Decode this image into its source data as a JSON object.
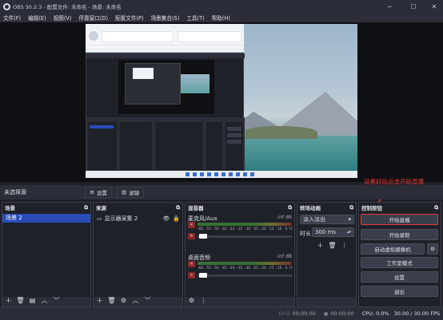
{
  "window": {
    "title": "OBS 30.2.3 - 配置文件: 未命名 - 场景: 未命名"
  },
  "menu": [
    "文件(F)",
    "编辑(E)",
    "视图(V)",
    "停靠窗口(D)",
    "配置文件(P)",
    "场景集合(S)",
    "工具(T)",
    "帮助(H)"
  ],
  "source_bar": {
    "label": "未选择源",
    "settings": "设置",
    "filters": "滤镜"
  },
  "annotation": "设置好后点击开始直播",
  "scenes": {
    "title": "场景",
    "items": [
      "场景 2"
    ]
  },
  "sources": {
    "title": "来源",
    "items": [
      "显示器采集 2"
    ]
  },
  "mixer": {
    "title": "混音器",
    "channels": [
      {
        "name": "麦克风/Aux",
        "level": "-inf dB"
      },
      {
        "name": "桌面音频",
        "level": "-inf dB"
      }
    ],
    "scale": [
      "-60",
      "-55",
      "-50",
      "-45",
      "-40",
      "-35",
      "-30",
      "-25",
      "-20",
      "-15",
      "-10",
      "-5",
      "0"
    ]
  },
  "transitions": {
    "title": "转场动画",
    "type": "淡入淡出",
    "duration_label": "时长",
    "duration": "300 ms"
  },
  "controls": {
    "title": "控制按钮",
    "buttons": [
      "开始直播",
      "开始录制",
      "启动虚拟摄像机",
      "工作室模式",
      "设置",
      "退出"
    ]
  },
  "status": {
    "stream_time": "00:00:00",
    "rec_time": "00:00:00",
    "cpu": "CPU: 0.0%",
    "fps": "30.00 / 30.00 FPS"
  },
  "colors": {
    "accent": "#284cb8",
    "annotation": "#e53935"
  }
}
